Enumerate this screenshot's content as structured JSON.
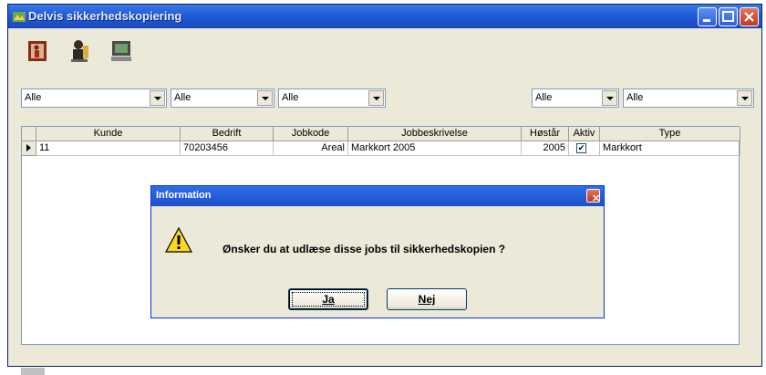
{
  "window": {
    "title": "Delvis sikkerhedskopiering",
    "toolbar": {
      "icons": [
        "exit-door-icon",
        "person-info-icon",
        "computer-icon"
      ]
    }
  },
  "filters": [
    "Alle",
    "Alle",
    "Alle",
    "Alle",
    "Alle"
  ],
  "grid": {
    "columns": [
      "Kunde",
      "Bedrift",
      "Jobkode",
      "Jobbeskrivelse",
      "Høstår",
      "Aktiv",
      "Type"
    ],
    "rows": [
      {
        "kunde": "11",
        "bedrift": "70203456",
        "jobkode": "Areal",
        "jobbeskrivelse": "Markkort 2005",
        "hostar": "2005",
        "aktiv": true,
        "type": "Markkort"
      }
    ]
  },
  "dialog": {
    "title": "Information",
    "message": "Ønsker du at udlæse disse jobs til sikkerhedskopien ?",
    "yes_label": "Ja",
    "no_label": "Nej",
    "icon": "warning-icon"
  },
  "colors": {
    "title_bar": "#245edc",
    "dialog_border": "#0831d9",
    "warning_yellow": "#f8d820"
  }
}
